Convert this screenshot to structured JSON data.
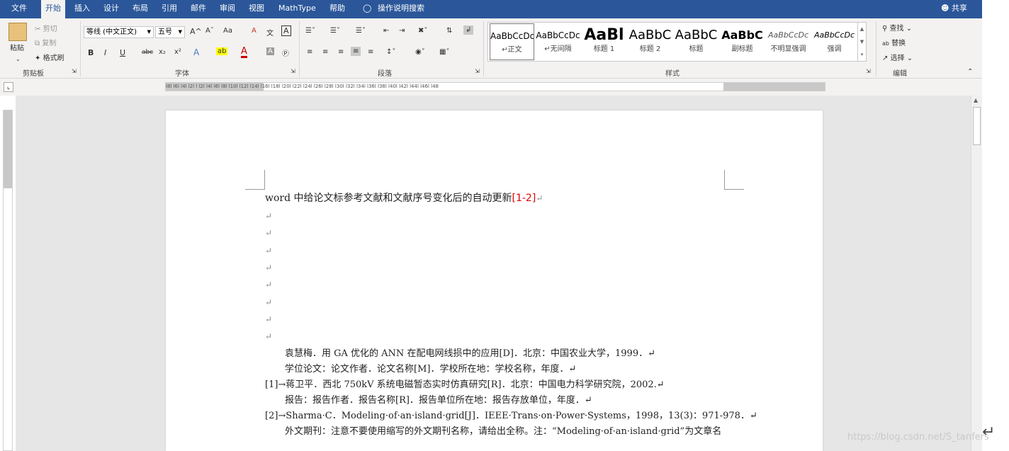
{
  "tabs": [
    "文件",
    "开始",
    "插入",
    "设计",
    "布局",
    "引用",
    "邮件",
    "审阅",
    "视图",
    "MathType",
    "帮助"
  ],
  "tell_me": "操作说明搜索",
  "share": "共享",
  "clipboard": {
    "paste": "粘贴",
    "cut": "剪切",
    "copy": "复制",
    "format_painter": "格式刷",
    "label": "剪贴板"
  },
  "font": {
    "name": "等线 (中文正文)",
    "size": "五号",
    "label": "字体",
    "bold": "B",
    "italic": "I",
    "underline": "U",
    "strike": "abc",
    "sub": "x₂",
    "sup": "x²",
    "grow": "A^",
    "shrink": "Aˇ",
    "case": "Aa",
    "clear": "A",
    "phonetic": "文",
    "border": "A"
  },
  "paragraph": {
    "label": "段落"
  },
  "styles": {
    "label": "样式",
    "items": [
      {
        "preview": "AaBbCcDc",
        "name": "↵正文"
      },
      {
        "preview": "AaBbCcDc",
        "name": "↵无间隔"
      },
      {
        "preview": "AaBl",
        "name": "标题 1"
      },
      {
        "preview": "AaBbC",
        "name": "标题 2"
      },
      {
        "preview": "AaBbC",
        "name": "标题"
      },
      {
        "preview": "AaBbC",
        "name": "副标题"
      },
      {
        "preview": "AaBbCcDc",
        "name": "不明显强调"
      },
      {
        "preview": "AaBbCcDc",
        "name": "强调"
      }
    ]
  },
  "editing": {
    "find": "查找",
    "replace": "替换",
    "select": "选择",
    "label": "编辑"
  },
  "ruler": {
    "text": "l8l l6l l4l l2l l l2l l4l l6l l8l l10l l12l l14l l16l l18l l20l l22l l24l l26l l28l l30l l32l l34l l36l l38l l40l l42l l44l l46l l48"
  },
  "document": {
    "title_text": "word 中给论文标参考文献和文献序号变化后的自动更新",
    "title_cite": "[1-2]",
    "para_mark": "↵",
    "lines": [
      "袁慧梅．用 GA 优化的 ANN 在配电网线损中的应用[D]．北京：中国农业大学，1999．↵",
      "学位论文：论文作者．论文名称[M]．学校所在地：学校名称，年度．↵",
      "[1]→蒋卫平．西北 750kV 系统电磁暂态实时仿真研究[R]．北京：中国电力科学研究院，2002.↵",
      "报告：报告作者．报告名称[R]．报告单位所在地：报告存放单位，年度．↵",
      "[2]→Sharma·C．Modeling·of·an·island·grid[J]．IEEE·Trans·on·Power·Systems，1998，13(3)：971-978．↵",
      "外文期刊：注意不要使用缩写的外文期刊名称，请给出全称。注：“Modeling·of·an·island·grid”为文章名"
    ]
  },
  "watermark": "https://blog.csdn.net/S_tanfers",
  "colors": {
    "accent": "#2b579a",
    "citation": "#e00000"
  }
}
